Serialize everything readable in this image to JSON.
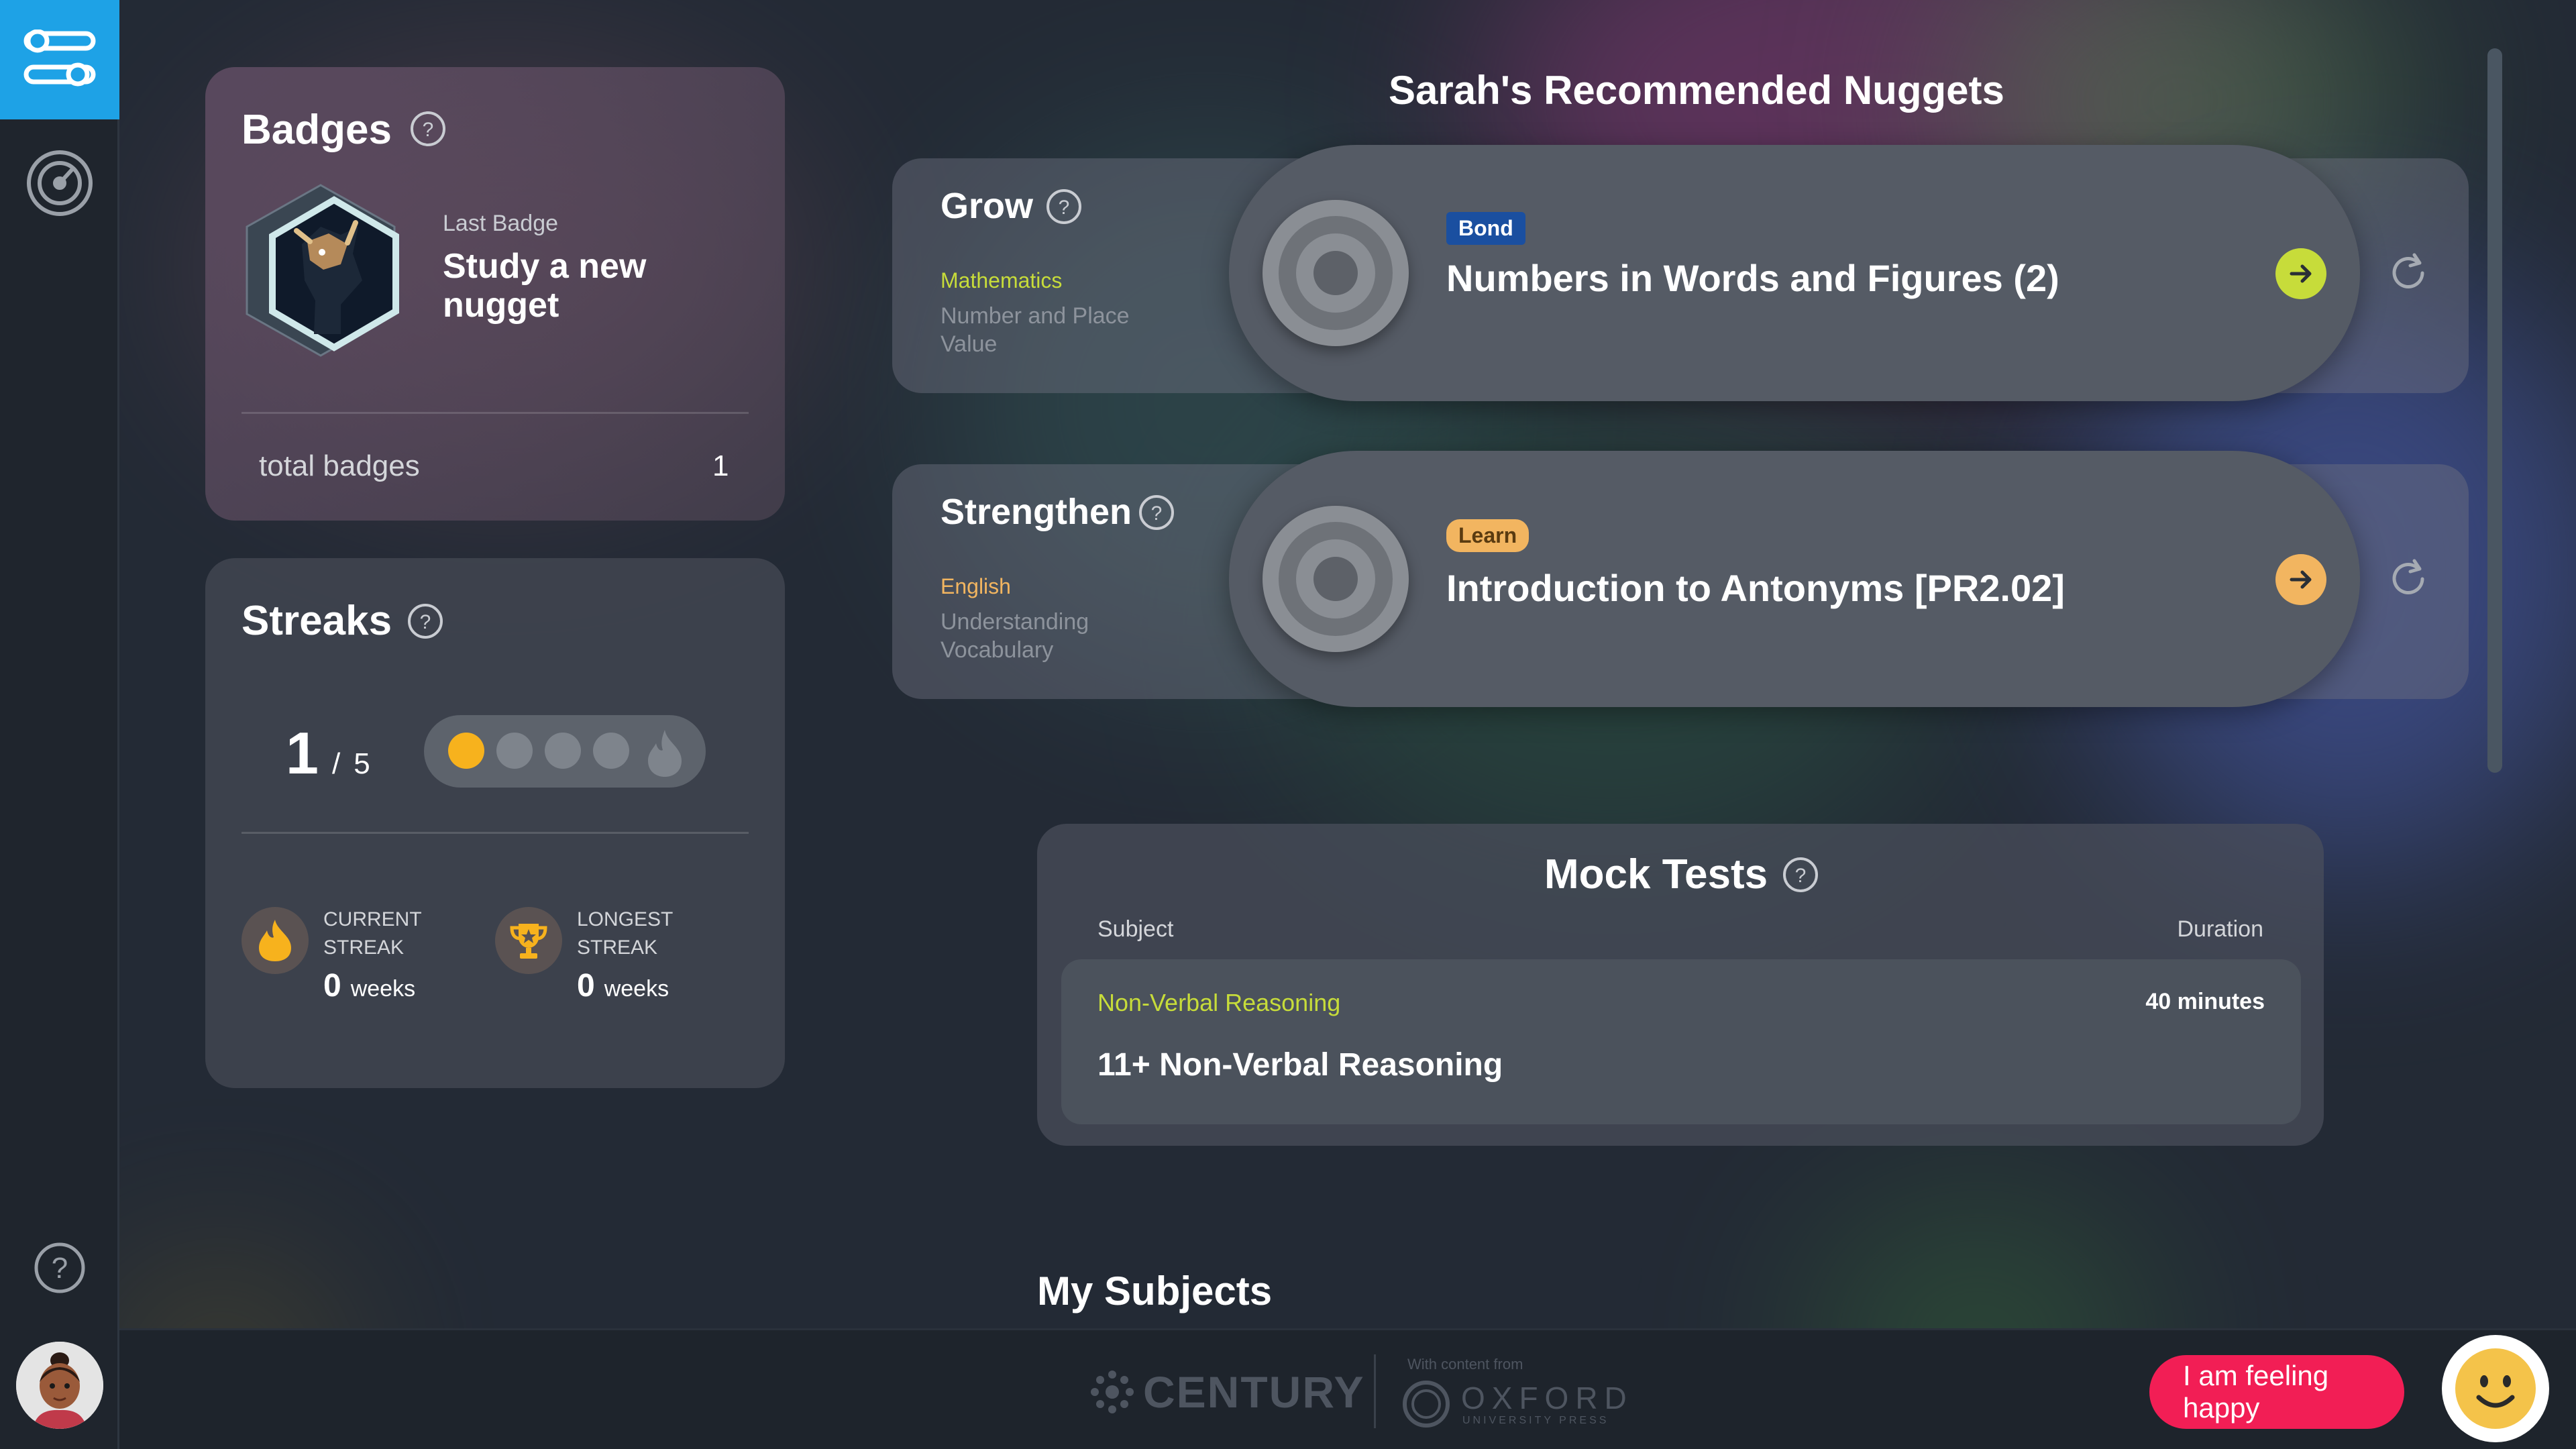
{
  "badges": {
    "title": "Badges",
    "last_badge_label": "Last Badge",
    "last_badge_name": "Study a new nugget",
    "total_label": "total badges",
    "total_value": "1"
  },
  "streaks": {
    "title": "Streaks",
    "current": "1",
    "separator": "/",
    "goal": "5",
    "progress_filled": 1,
    "progress_total": 5,
    "current_label_1": "CURRENT",
    "current_label_2": "STREAK",
    "current_value": "0",
    "current_unit": "weeks",
    "longest_label_1": "LONGEST",
    "longest_label_2": "STREAK",
    "longest_value": "0",
    "longest_unit": "weeks"
  },
  "nuggets": {
    "title": "Sarah's Recommended Nuggets",
    "items": [
      {
        "type": "Grow",
        "subject": "Mathematics",
        "topic_line1": "Number and Place",
        "topic_line2": "Value",
        "tag": "Bond",
        "name": "Numbers in Words and Figures (2)",
        "subject_color": "#c7dc3a",
        "arrow_color": "#c7dc3a"
      },
      {
        "type": "Strengthen",
        "subject": "English",
        "topic_line1": "Understanding",
        "topic_line2": "Vocabulary",
        "tag": "Learn",
        "name": "Introduction to Antonyms [PR2.02]",
        "subject_color": "#f2b560",
        "arrow_color": "#f2b560"
      }
    ]
  },
  "mock_tests": {
    "title": "Mock Tests",
    "col_subject": "Subject",
    "col_duration": "Duration",
    "rows": [
      {
        "subject": "Non-Verbal Reasoning",
        "duration": "40 minutes",
        "name": "11+ Non-Verbal Reasoning"
      }
    ]
  },
  "my_subjects": {
    "title": "My Subjects"
  },
  "footer": {
    "brand": "CENTURY",
    "with_content": "With content from",
    "partner": "OXFORD",
    "partner_sub": "UNIVERSITY PRESS"
  },
  "mood": {
    "label": "I am feeling happy"
  },
  "colors": {
    "accent_blue": "#1ea2e6",
    "mood_red": "#f21e55",
    "streak_gold": "#f7b21d",
    "green_subject": "#c7dc3a"
  }
}
